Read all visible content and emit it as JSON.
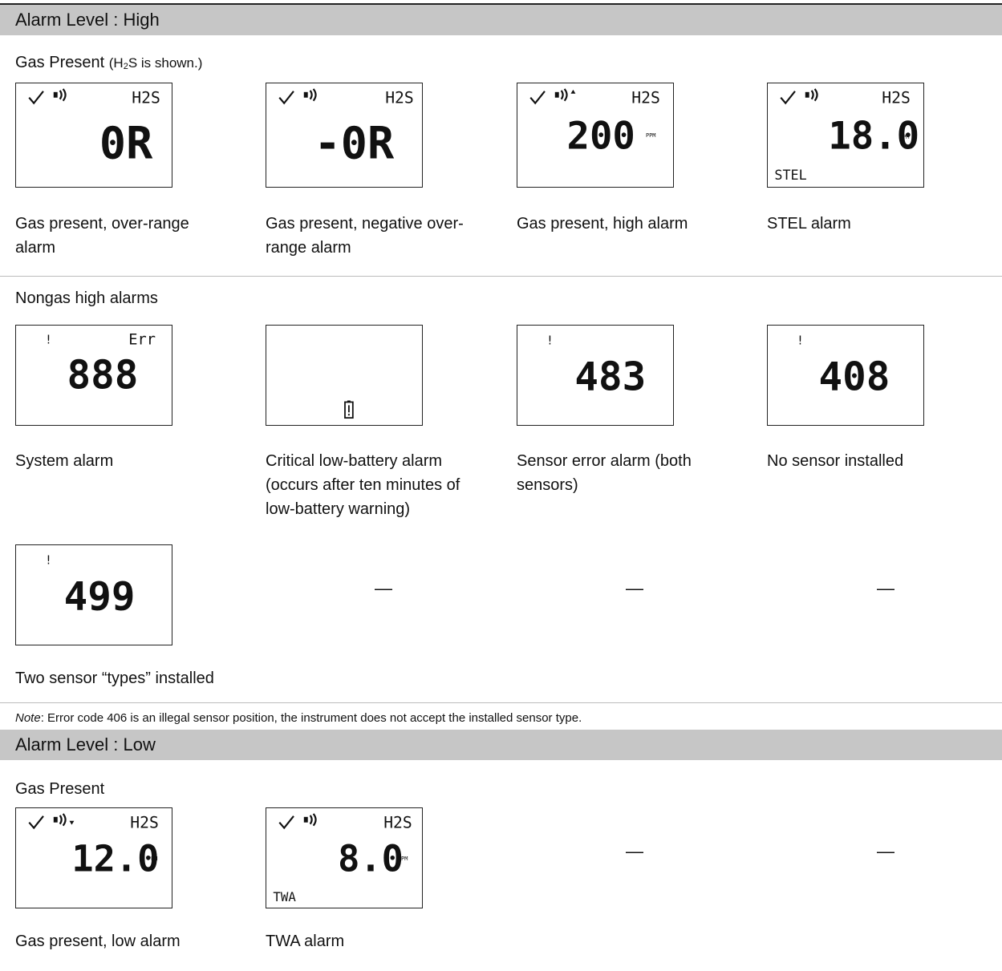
{
  "high": {
    "band_title": "Alarm Level : High",
    "gas_present_label": "Gas Present",
    "gas_note_pre": "(H",
    "gas_note_sub": "2",
    "gas_note_post": "S is shown.)",
    "gas_items": [
      {
        "caption": "Gas present, over-range alarm",
        "gas": "H2S",
        "reading": "0R",
        "checkmark": true,
        "alarm_arrow": "",
        "unit": "",
        "mode": ""
      },
      {
        "caption": "Gas present, negative over-range alarm",
        "gas": "H2S",
        "reading": "-0R",
        "checkmark": true,
        "alarm_arrow": "",
        "unit": "",
        "mode": ""
      },
      {
        "caption": "Gas present, high alarm",
        "gas": "H2S",
        "reading": "200",
        "checkmark": true,
        "alarm_arrow": "up",
        "unit": "PPM",
        "mode": ""
      },
      {
        "caption": "STEL alarm",
        "gas": "H2S",
        "reading": "18.0",
        "checkmark": true,
        "alarm_arrow": "",
        "unit": "PPM",
        "mode": "STEL"
      }
    ],
    "nongas_label": "Nongas high alarms",
    "nongas_items": [
      {
        "caption": "System alarm",
        "reading": "888",
        "error_tag": "Err",
        "exclamation": true
      },
      {
        "caption": "Critical low-battery alarm (occurs after ten minutes of low-battery warning)",
        "reading": "",
        "battery_icon": true,
        "exclamation": false
      },
      {
        "caption": "Sensor error alarm (both sensors)",
        "reading": "483",
        "exclamation": true
      },
      {
        "caption": "No sensor installed",
        "reading": "408",
        "exclamation": true
      }
    ],
    "extra_items": [
      {
        "caption": "Two sensor “types” installed",
        "reading": "499",
        "exclamation": true
      }
    ],
    "empty_cell": "—",
    "note_label": "Note",
    "note_text": ": Error code 406 is an illegal sensor position, the instrument does not accept the installed sensor type."
  },
  "low": {
    "band_title": "Alarm Level : Low",
    "gas_present_label": "Gas Present",
    "gas_items": [
      {
        "caption": "Gas present, low alarm",
        "gas": "H2S",
        "reading": "12.0",
        "checkmark": true,
        "alarm_arrow": "down",
        "unit": "PPM",
        "mode": ""
      },
      {
        "caption": "TWA alarm",
        "gas": "H2S",
        "reading": "8.0",
        "checkmark": true,
        "alarm_arrow": "",
        "unit": "PPM",
        "mode": "TWA"
      }
    ],
    "empty_cell": "—"
  },
  "icons": [
    "check-icon",
    "speaker-icon",
    "alarm-up-arrow-icon",
    "alarm-down-arrow-icon",
    "exclamation-icon",
    "battery-warning-icon"
  ]
}
